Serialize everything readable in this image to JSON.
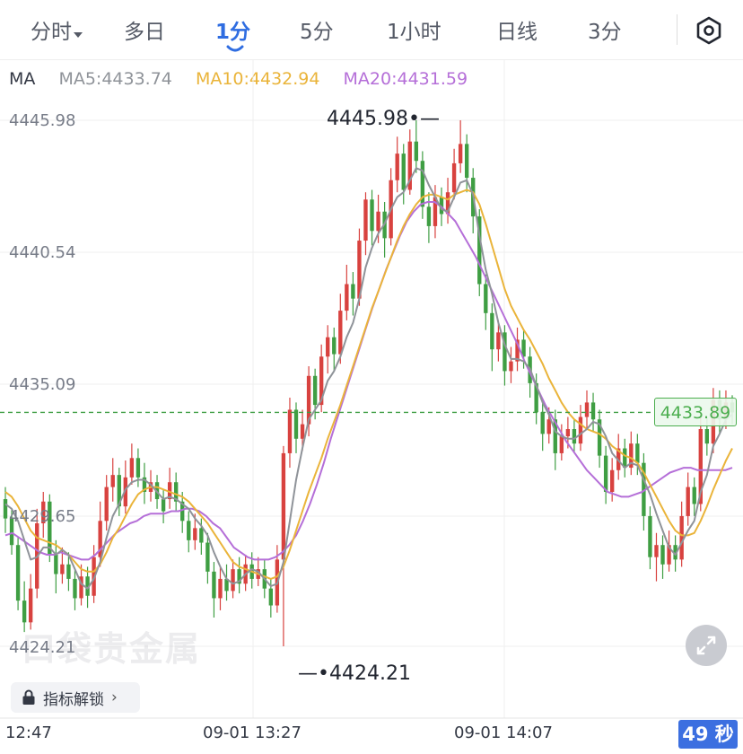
{
  "tabs": [
    {
      "label": "分时",
      "has_caret": true,
      "active": false
    },
    {
      "label": "多日",
      "active": false
    },
    {
      "label": "1分",
      "active": true
    },
    {
      "label": "5分",
      "active": false
    },
    {
      "label": "1小时",
      "active": false
    },
    {
      "label": "日线",
      "active": false
    },
    {
      "label": "3分",
      "active": false
    }
  ],
  "indicators": {
    "ma_label": "MA",
    "ma5": "MA5:4433.74",
    "ma10": "MA10:4432.94",
    "ma20": "MA20:4431.59"
  },
  "colors": {
    "active_tab": "#2f6de1",
    "up": "#d8423f",
    "down": "#3f9e43",
    "ma5": "#8f9399",
    "ma10": "#eab43a",
    "ma20": "#b56fd8",
    "current_price_line": "#3f9e43"
  },
  "icons": {
    "settings": "hexagon-settings-icon",
    "lock": "lock-icon",
    "expand": "expand-icon"
  },
  "price_axis": [
    "4445.98",
    "4440.54",
    "4435.09",
    "4429.65",
    "4424.21"
  ],
  "time_axis": [
    "12:47",
    "09-01 13:27",
    "09-01 14:07"
  ],
  "annotations": {
    "high": "4445.98",
    "low": "4424.21",
    "current": "4433.89"
  },
  "lock_button": {
    "label": "指标解锁",
    "arrow": "›"
  },
  "countdown": "49 秒",
  "watermark": "口袋贵金属",
  "chart_data": {
    "type": "candlestick",
    "ylim": [
      4424.21,
      4445.98
    ],
    "current_price": 4433.89,
    "candles": [
      [
        4430.3,
        4429.5,
        4430.8,
        4428.9
      ],
      [
        4429.5,
        4428.4,
        4429.9,
        4428.0
      ],
      [
        4428.4,
        4426.1,
        4428.7,
        4425.7
      ],
      [
        4426.1,
        4425.2,
        4426.9,
        4424.8
      ],
      [
        4425.2,
        4426.6,
        4427.2,
        4424.9
      ],
      [
        4426.6,
        4429.3,
        4429.9,
        4426.2
      ],
      [
        4429.3,
        4430.2,
        4430.6,
        4428.7
      ],
      [
        4430.2,
        4428.0,
        4430.5,
        4427.7
      ],
      [
        4428.0,
        4427.2,
        4428.6,
        4426.4
      ],
      [
        4427.2,
        4427.6,
        4428.3,
        4426.8
      ],
      [
        4427.6,
        4427.0,
        4428.1,
        4426.5
      ],
      [
        4427.0,
        4426.2,
        4427.4,
        4425.7
      ],
      [
        4426.2,
        4427.1,
        4427.6,
        4425.9
      ],
      [
        4427.1,
        4426.3,
        4427.5,
        4425.8
      ],
      [
        4426.3,
        4427.9,
        4428.4,
        4426.0
      ],
      [
        4427.9,
        4429.4,
        4430.2,
        4427.5
      ],
      [
        4429.4,
        4430.8,
        4431.3,
        4429.0
      ],
      [
        4430.8,
        4431.3,
        4432.0,
        4430.2
      ],
      [
        4431.3,
        4430.0,
        4431.6,
        4429.6
      ],
      [
        4430.0,
        4431.2,
        4431.9,
        4429.7
      ],
      [
        4431.2,
        4432.0,
        4432.6,
        4430.9
      ],
      [
        4432.0,
        4431.2,
        4432.4,
        4430.8
      ],
      [
        4431.2,
        4430.6,
        4431.8,
        4430.1
      ],
      [
        4430.6,
        4431.0,
        4431.5,
        4430.2
      ],
      [
        4431.0,
        4430.3,
        4431.3,
        4429.9
      ],
      [
        4430.3,
        4429.8,
        4430.7,
        4429.3
      ],
      [
        4430.3,
        4431.0,
        4431.6,
        4429.9
      ],
      [
        4431.0,
        4430.2,
        4431.4,
        4429.8
      ],
      [
        4430.2,
        4429.4,
        4430.6,
        4428.9
      ],
      [
        4429.4,
        4428.6,
        4429.8,
        4428.1
      ],
      [
        4428.6,
        4429.1,
        4429.7,
        4428.2
      ],
      [
        4429.1,
        4428.5,
        4429.5,
        4428.0
      ],
      [
        4428.5,
        4427.3,
        4428.9,
        4426.8
      ],
      [
        4427.3,
        4426.2,
        4427.7,
        4425.4
      ],
      [
        4426.2,
        4427.0,
        4427.5,
        4425.7
      ],
      [
        4427.0,
        4426.5,
        4427.6,
        4426.1
      ],
      [
        4426.5,
        4427.4,
        4427.8,
        4426.2
      ],
      [
        4427.4,
        4426.8,
        4427.9,
        4426.4
      ],
      [
        4426.8,
        4427.6,
        4428.0,
        4426.5
      ],
      [
        4427.6,
        4427.0,
        4428.1,
        4426.6
      ],
      [
        4427.0,
        4427.4,
        4427.9,
        4426.7
      ],
      [
        4427.4,
        4426.6,
        4427.8,
        4426.2
      ],
      [
        4426.6,
        4425.9,
        4427.0,
        4425.4
      ],
      [
        4425.9,
        4427.8,
        4428.4,
        4425.6
      ],
      [
        4427.8,
        4432.2,
        4432.5,
        4424.21
      ],
      [
        4432.2,
        4434.0,
        4434.5,
        4431.6
      ],
      [
        4434.0,
        4432.8,
        4434.3,
        4432.2
      ],
      [
        4432.8,
        4433.4,
        4434.0,
        4432.3
      ],
      [
        4433.4,
        4435.4,
        4435.8,
        4432.9
      ],
      [
        4435.4,
        4434.2,
        4435.7,
        4433.6
      ],
      [
        4434.2,
        4436.2,
        4436.7,
        4433.9
      ],
      [
        4436.2,
        4437.0,
        4437.5,
        4435.5
      ],
      [
        4437.0,
        4436.3,
        4437.4,
        4435.6
      ],
      [
        4436.3,
        4438.1,
        4438.8,
        4435.9
      ],
      [
        4438.1,
        4439.2,
        4440.0,
        4437.7
      ],
      [
        4439.2,
        4438.6,
        4439.7,
        4437.9
      ],
      [
        4438.6,
        4441.0,
        4441.5,
        4438.3
      ],
      [
        4441.0,
        4442.7,
        4443.0,
        4440.4
      ],
      [
        4442.7,
        4441.4,
        4443.1,
        4440.8
      ],
      [
        4441.4,
        4442.2,
        4442.9,
        4440.9
      ],
      [
        4442.2,
        4441.1,
        4442.6,
        4440.3
      ],
      [
        4441.1,
        4443.5,
        4444.0,
        4440.8
      ],
      [
        4443.5,
        4444.6,
        4445.3,
        4443.0
      ],
      [
        4444.6,
        4443.1,
        4445.0,
        4442.5
      ],
      [
        4443.1,
        4445.1,
        4445.6,
        4442.9
      ],
      [
        4445.1,
        4444.3,
        4445.98,
        4443.8
      ],
      [
        4444.3,
        4442.4,
        4444.7,
        4441.9
      ],
      [
        4442.4,
        4441.6,
        4443.0,
        4440.9
      ],
      [
        4441.6,
        4442.8,
        4443.3,
        4441.1
      ],
      [
        4442.8,
        4442.1,
        4443.2,
        4441.6
      ],
      [
        4442.1,
        4443.0,
        4443.6,
        4441.7
      ],
      [
        4443.0,
        4444.2,
        4444.8,
        4442.7
      ],
      [
        4444.2,
        4445.0,
        4445.98,
        4443.8
      ],
      [
        4445.0,
        4443.6,
        4445.4,
        4443.0
      ],
      [
        4443.6,
        4442.0,
        4444.0,
        4441.3
      ],
      [
        4442.0,
        4439.2,
        4442.3,
        4438.7
      ],
      [
        4439.2,
        4438.0,
        4439.6,
        4437.3
      ],
      [
        4438.0,
        4436.5,
        4438.4,
        4435.6
      ],
      [
        4436.5,
        4437.2,
        4437.7,
        4436.0
      ],
      [
        4437.2,
        4435.6,
        4437.5,
        4435.0
      ],
      [
        4435.6,
        4436.0,
        4436.6,
        4435.1
      ],
      [
        4436.0,
        4436.9,
        4437.4,
        4435.6
      ],
      [
        4436.9,
        4436.2,
        4437.3,
        4435.7
      ],
      [
        4436.2,
        4435.1,
        4436.6,
        4434.5
      ],
      [
        4435.1,
        4433.9,
        4435.5,
        4433.4
      ],
      [
        4433.9,
        4433.0,
        4434.3,
        4432.3
      ],
      [
        4433.0,
        4433.6,
        4434.1,
        4432.6
      ],
      [
        4433.6,
        4432.2,
        4434.0,
        4431.5
      ],
      [
        4432.2,
        4432.9,
        4433.4,
        4431.9
      ],
      [
        4432.9,
        4433.2,
        4433.7,
        4432.4
      ],
      [
        4433.2,
        4432.6,
        4433.6,
        4432.2
      ],
      [
        4432.6,
        4433.7,
        4434.2,
        4432.3
      ],
      [
        4433.7,
        4434.3,
        4434.8,
        4433.2
      ],
      [
        4434.3,
        4433.6,
        4434.7,
        4433.1
      ],
      [
        4433.6,
        4432.1,
        4434.0,
        4431.6
      ],
      [
        4432.1,
        4430.6,
        4432.5,
        4430.1
      ],
      [
        4430.6,
        4431.5,
        4432.0,
        4430.2
      ],
      [
        4431.5,
        4432.4,
        4433.0,
        4431.1
      ],
      [
        4432.4,
        4431.6,
        4432.8,
        4431.2
      ],
      [
        4431.6,
        4432.6,
        4433.1,
        4431.3
      ],
      [
        4432.6,
        4431.8,
        4433.0,
        4431.3
      ],
      [
        4431.8,
        4429.6,
        4432.2,
        4429.0
      ],
      [
        4429.6,
        4427.9,
        4430.0,
        4427.4
      ],
      [
        4427.9,
        4428.4,
        4428.9,
        4426.9
      ],
      [
        4428.4,
        4427.6,
        4428.8,
        4427.0
      ],
      [
        4427.6,
        4428.4,
        4429.0,
        4427.3
      ],
      [
        4428.4,
        4427.8,
        4428.8,
        4427.3
      ],
      [
        4427.8,
        4429.6,
        4430.2,
        4427.5
      ],
      [
        4429.6,
        4430.8,
        4431.4,
        4429.2
      ],
      [
        4430.8,
        4430.1,
        4431.2,
        4429.6
      ],
      [
        4430.1,
        4433.2,
        4433.9,
        4429.8
      ],
      [
        4433.2,
        4432.6,
        4433.7,
        4432.1
      ],
      [
        4432.6,
        4434.4,
        4434.9,
        4432.2
      ],
      [
        4434.4,
        4433.6,
        4434.8,
        4433.0
      ],
      [
        4433.6,
        4434.3,
        4434.8,
        4433.2
      ],
      [
        4434.3,
        4433.89,
        4434.6,
        4433.4
      ]
    ],
    "ma5": [
      4430.1,
      4429.9,
      4429.4,
      4428.6,
      4427.8,
      4427.9,
      4428.3,
      4428.3,
      4428.0,
      4428.2,
      4428.0,
      4427.4,
      4426.8,
      4426.6,
      4427.0,
      4427.7,
      4428.7,
      4429.6,
      4430.1,
      4430.7,
      4431.0,
      4431.1,
      4431.1,
      4430.9,
      4430.6,
      4430.3,
      4430.4,
      4430.3,
      4430.1,
      4429.9,
      4429.5,
      4429.2,
      4428.8,
      4428.1,
      4427.5,
      4427.0,
      4426.8,
      4426.9,
      4427.2,
      4427.4,
      4427.3,
      4427.0,
      4426.7,
      4426.8,
      4427.7,
      4429.4,
      4431.1,
      4432.4,
      4433.6,
      4434.0,
      4434.4,
      4435.2,
      4435.6,
      4436.2,
      4437.0,
      4437.6,
      4438.6,
      4439.9,
      4440.7,
      4441.3,
      4441.7,
      4442.3,
      4442.8,
      4443.0,
      4443.5,
      4444.0,
      4443.9,
      4443.3,
      4442.8,
      4442.3,
      4442.2,
      4442.8,
      4443.4,
      4443.5,
      4442.9,
      4441.2,
      4439.8,
      4438.8,
      4437.6,
      4436.7,
      4436.1,
      4436.1,
      4436.0,
      4435.7,
      4435.0,
      4434.3,
      4433.8,
      4433.1,
      4432.9,
      4432.8,
      4432.8,
      4433.0,
      4433.2,
      4433.5,
      4433.4,
      4432.9,
      4432.2,
      4431.9,
      4431.6,
      4431.8,
      4431.7,
      4431.1,
      4430.5,
      4429.7,
      4429.0,
      4428.3,
      4428.0,
      4428.5,
      4429.0,
      4429.4,
      4430.6,
      4431.3,
      4432.5,
      4433.0,
      4433.6,
      4433.8
    ],
    "ma10": [
      4430.6,
      4430.4,
      4430.0,
      4429.5,
      4429.0,
      4428.7,
      4428.6,
      4428.5,
      4428.4,
      4428.2,
      4428.0,
      4427.7,
      4427.4,
      4427.3,
      4427.3,
      4427.6,
      4428.1,
      4428.7,
      4429.1,
      4429.6,
      4430.1,
      4430.5,
      4430.7,
      4430.8,
      4430.8,
      4430.7,
      4430.6,
      4430.5,
      4430.4,
      4430.2,
      4429.9,
      4429.6,
      4429.3,
      4428.9,
      4428.5,
      4428.1,
      4427.7,
      4427.5,
      4427.4,
      4427.3,
      4427.2,
      4427.1,
      4427.0,
      4427.1,
      4427.5,
      4428.2,
      4429.0,
      4429.8,
      4430.6,
      4431.3,
      4432.0,
      4432.8,
      4433.5,
      4434.2,
      4435.0,
      4435.8,
      4436.6,
      4437.4,
      4438.2,
      4438.9,
      4439.6,
      4440.3,
      4441.0,
      4441.6,
      4442.1,
      4442.5,
      4442.8,
      4442.9,
      4442.9,
      4442.8,
      4442.7,
      4442.9,
      4443.0,
      4443.1,
      4443.0,
      4442.5,
      4441.7,
      4440.8,
      4439.9,
      4439.0,
      4438.3,
      4437.8,
      4437.3,
      4436.9,
      4436.4,
      4435.9,
      4435.3,
      4434.8,
      4434.3,
      4433.9,
      4433.6,
      4433.4,
      4433.2,
      4433.1,
      4433.0,
      4432.8,
      4432.5,
      4432.3,
      4432.1,
      4432.0,
      4431.8,
      4431.4,
      4430.9,
      4430.4,
      4429.9,
      4429.4,
      4429.0,
      4428.8,
      4428.8,
      4428.9,
      4429.4,
      4430.0,
      4430.7,
      4431.3,
      4431.9,
      4432.4
    ],
    "ma20": [
      4428.8,
      4428.9,
      4428.7,
      4428.5,
      4428.3,
      4428.1,
      4428.0,
      4428.0,
      4428.1,
      4428.0,
      4427.9,
      4427.8,
      4427.8,
      4428.0,
      4428.3,
      4428.6,
      4428.9,
      4429.1,
      4429.3,
      4429.4,
      4429.6,
      4429.7,
      4429.7,
      4429.7,
      4429.8,
      4429.8,
      4429.9,
      4429.9,
      4429.8,
      4429.6,
      4429.3,
      4429.1,
      4428.7,
      4428.3,
      4428.1,
      4427.9,
      4427.8,
      4427.8,
      4427.8,
      4427.9,
      4428.1,
      4428.4,
      4428.8,
      4429.4,
      4430.1,
      4430.9,
      4431.8,
      4432.8,
      4433.7,
      4434.6,
      4435.5,
      4436.4,
      4437.3,
      4438.2,
      4439.0,
      4439.8,
      4440.5,
      4441.2,
      4441.8,
      4442.2,
      4442.5,
      4442.6,
      4442.6,
      4442.4,
      4442.1,
      4441.8,
      4441.3,
      4440.8,
      4440.3,
      4439.7,
      4439.1,
      4438.5,
      4437.9,
      4437.3,
      4436.7,
      4436.0,
      4435.4,
      4434.8,
      4434.2,
      4433.7,
      4433.2,
      4432.7,
      4432.3,
      4431.9,
      4431.5,
      4431.2,
      4430.9,
      4430.6,
      4430.5,
      4430.4,
      4430.4,
      4430.5,
      4430.6,
      4430.8,
      4431.0,
      4431.2,
      4431.4,
      4431.5,
      4431.6,
      4431.6,
      4431.5,
      4431.5,
      4431.5,
      4431.5,
      4431.5,
      4431.6
    ]
  }
}
